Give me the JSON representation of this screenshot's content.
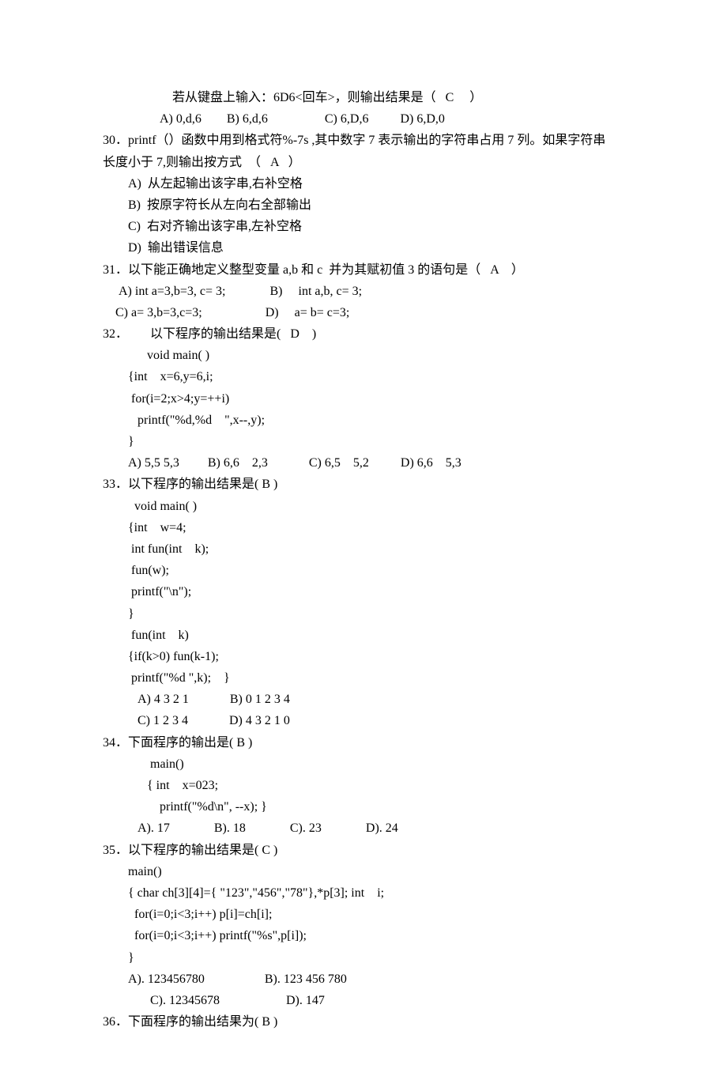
{
  "lines": [
    {
      "cls": "indent8",
      "text": "若从键盘上输入：6D6<回车>，则输出结果是（   C     ）"
    },
    {
      "cls": "indent7",
      "text": "A) 0,d,6        B) 6,d,6                  C) 6,D,6          D) 6,D,0"
    },
    {
      "cls": "indent1",
      "text": "30．printf（）函数中用到格式符%-7s ,其中数字 7 表示输出的字符串占用 7 列。如果字符串"
    },
    {
      "cls": "indent1",
      "text": "长度小于 7,则输出按方式  （   A   ）"
    },
    {
      "cls": "indent4",
      "text": "A)  从左起输出该字串,右补空格"
    },
    {
      "cls": "indent4",
      "text": "B)  按原字符长从左向右全部输出"
    },
    {
      "cls": "indent4",
      "text": "C)  右对齐输出该字串,左补空格"
    },
    {
      "cls": "indent4",
      "text": "D)  输出错误信息"
    },
    {
      "cls": "indent1",
      "text": "31．以下能正确地定义整型变量 a,b 和 c  并为其赋初值 3 的语句是（   A    ）"
    },
    {
      "cls": "indent2",
      "text": " A) int a=3,b=3, c= 3;              B)     int a,b, c= 3;"
    },
    {
      "cls": "indent2",
      "text": "C) a= 3,b=3,c=3;                    D)     a= b= c=3;"
    },
    {
      "cls": "indent1",
      "text": "32．       以下程序的输出结果是(   D    )"
    },
    {
      "cls": "indent6",
      "text": "void main( )"
    },
    {
      "cls": "indent4",
      "text": "{int    x=6,y=6,i;"
    },
    {
      "cls": "indent4",
      "text": " for(i=2;x>4;y=++i)"
    },
    {
      "cls": "indent4",
      "text": "   printf(\"%d,%d    \",x--,y);"
    },
    {
      "cls": "indent4",
      "text": "}"
    },
    {
      "cls": "indent4",
      "text": "A) 5,5 5,3         B) 6,6    2,3             C) 6,5    5,2          D) 6,6    5,3"
    },
    {
      "cls": "indent1",
      "text": "33．以下程序的输出结果是( B )"
    },
    {
      "cls": "indent5",
      "text": "void main( )"
    },
    {
      "cls": "indent4",
      "text": "{int    w=4;"
    },
    {
      "cls": "indent4",
      "text": " int fun(int    k);"
    },
    {
      "cls": "indent4",
      "text": " fun(w);"
    },
    {
      "cls": "indent4",
      "text": " printf(\"\\n\");"
    },
    {
      "cls": "indent4",
      "text": "}"
    },
    {
      "cls": "indent4",
      "text": " fun(int    k)"
    },
    {
      "cls": "indent4",
      "text": "{if(k>0) fun(k-1);"
    },
    {
      "cls": "indent4",
      "text": " printf(\"%d \",k);    }"
    },
    {
      "cls": "indent5",
      "text": " A) 4 3 2 1             B) 0 1 2 3 4"
    },
    {
      "cls": "indent5",
      "text": " C) 1 2 3 4             D) 4 3 2 1 0"
    },
    {
      "cls": "indent1",
      "text": "34．下面程序的输出是( B )"
    },
    {
      "cls": "indent6",
      "text": " main()"
    },
    {
      "cls": "indent6",
      "text": "{ int    x=023;"
    },
    {
      "cls": "indent6",
      "text": "    printf(\"%d\\n\", --x); }"
    },
    {
      "cls": "indent5",
      "text": " A). 17              B). 18              C). 23              D). 24"
    },
    {
      "cls": "indent1",
      "text": "35．以下程序的输出结果是( C )"
    },
    {
      "cls": "indent4",
      "text": "main()"
    },
    {
      "cls": "indent4",
      "text": "{ char ch[3][4]={ \"123\",\"456\",\"78\"},*p[3]; int    i;"
    },
    {
      "cls": "indent4",
      "text": "  for(i=0;i<3;i++) p[i]=ch[i];"
    },
    {
      "cls": "indent4",
      "text": "  for(i=0;i<3;i++) printf(\"%s\",p[i]);"
    },
    {
      "cls": "indent4",
      "text": "}"
    },
    {
      "cls": "indent4",
      "text": "A). 123456780                   B). 123 456 780"
    },
    {
      "cls": "indent6",
      "text": " C). 12345678                     D). 147"
    },
    {
      "cls": "indent1",
      "text": "36．下面程序的输出结果为( B )"
    }
  ]
}
